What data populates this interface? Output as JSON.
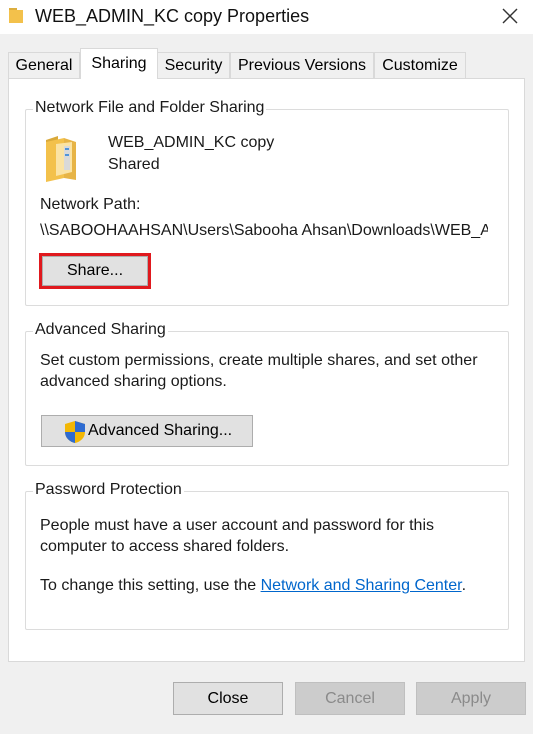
{
  "window": {
    "title": "WEB_ADMIN_KC copy Properties"
  },
  "tabs": [
    {
      "label": "General"
    },
    {
      "label": "Sharing",
      "active": true
    },
    {
      "label": "Security"
    },
    {
      "label": "Previous Versions"
    },
    {
      "label": "Customize"
    }
  ],
  "network_sharing": {
    "group_title": "Network File and Folder Sharing",
    "folder_name": "WEB_ADMIN_KC copy",
    "folder_status": "Shared",
    "network_path_label": "Network Path:",
    "network_path_value": "\\\\SABOOHAAHSAN\\Users\\Sabooha Ahsan\\Downloads\\WEB_A",
    "share_button": "Share..."
  },
  "advanced_sharing": {
    "group_title": "Advanced Sharing",
    "description_line1": "Set custom permissions, create multiple shares, and set other",
    "description_line2": "advanced sharing options.",
    "button": "Advanced Sharing..."
  },
  "password_protection": {
    "group_title": "Password Protection",
    "line1": "People must have a user account and password for this",
    "line2": "computer to access shared folders.",
    "change_prefix": "To change this setting, use the ",
    "link_text": "Network and Sharing Center",
    "change_suffix": "."
  },
  "footer": {
    "close": "Close",
    "cancel": "Cancel",
    "apply": "Apply"
  },
  "colors": {
    "highlight": "#e0191e",
    "link": "#0066cc",
    "folder": "#f3c14b"
  },
  "icons": {
    "title": "folder-icon",
    "close": "close-icon",
    "folder": "shared-folder-icon",
    "shield": "uac-shield-icon"
  }
}
